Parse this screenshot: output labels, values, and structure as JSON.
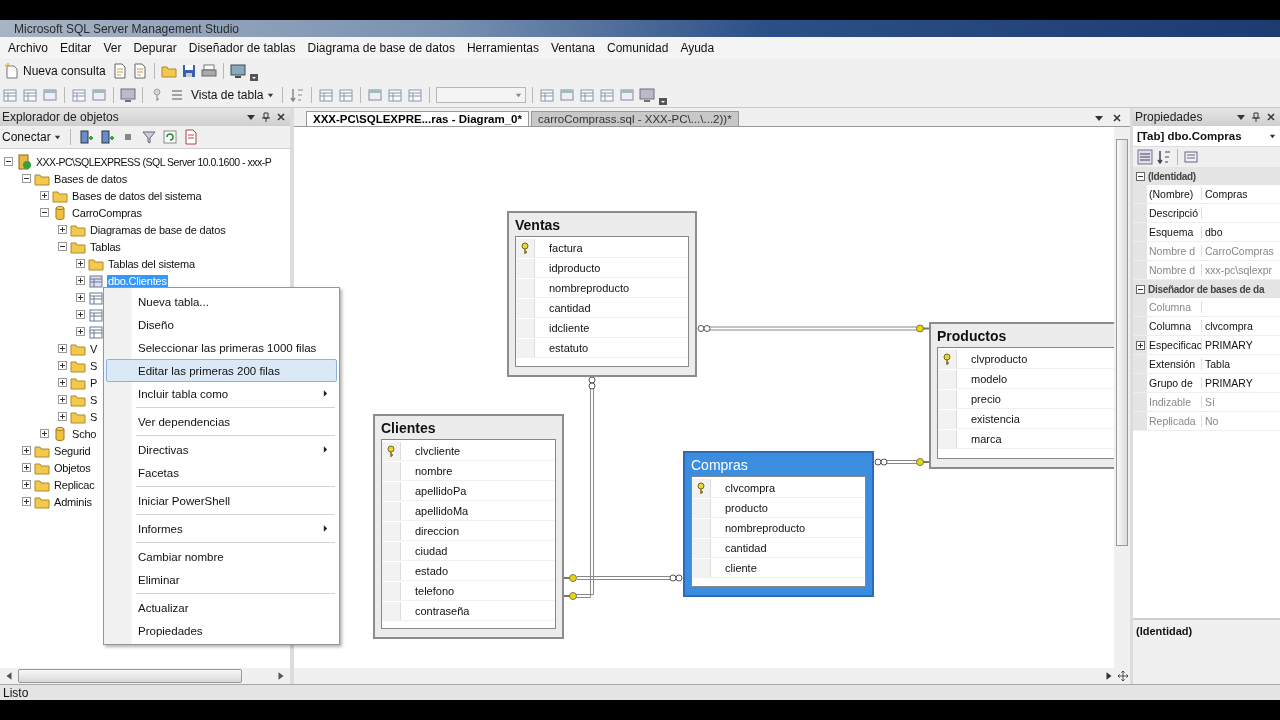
{
  "window": {
    "title": "Microsoft SQL Server Management Studio"
  },
  "menu": [
    "Archivo",
    "Editar",
    "Ver",
    "Depurar",
    "Diseñador de tablas",
    "Diagrama de base de datos",
    "Herramientas",
    "Ventana",
    "Comunidad",
    "Ayuda"
  ],
  "toolbar": {
    "new_query": "Nueva consulta",
    "view_button": "Vista de tabla"
  },
  "object_explorer": {
    "title": "Explorador de objetos",
    "connect": "Conectar",
    "tree": [
      {
        "label": "XXX-PC\\SQLEXPRESS (SQL Server 10.0.1600 - xxx-P",
        "kind": "server",
        "expanded": true,
        "selected": false,
        "children": [
          {
            "label": "Bases de datos",
            "kind": "folder",
            "expanded": true,
            "selected": false,
            "children": [
              {
                "label": "Bases de datos del sistema",
                "kind": "folder",
                "expanded": false,
                "selected": false
              },
              {
                "label": "CarroCompras",
                "kind": "database",
                "expanded": true,
                "selected": false,
                "children": [
                  {
                    "label": "Diagramas de base de datos",
                    "kind": "folder",
                    "expanded": false,
                    "selected": false
                  },
                  {
                    "label": "Tablas",
                    "kind": "folder",
                    "expanded": true,
                    "selected": false,
                    "children": [
                      {
                        "label": "Tablas del sistema",
                        "kind": "folder",
                        "expanded": false,
                        "selected": false
                      },
                      {
                        "label": "dbo.Clientes",
                        "kind": "table",
                        "expanded": false,
                        "selected": true
                      },
                      {
                        "kind": "table",
                        "expanded": false,
                        "selected": false
                      },
                      {
                        "kind": "table",
                        "expanded": false,
                        "selected": false
                      },
                      {
                        "kind": "table",
                        "expanded": false,
                        "selected": false
                      }
                    ]
                  },
                  {
                    "label": "V",
                    "kind": "folder",
                    "expanded": false,
                    "selected": false
                  },
                  {
                    "label": "S",
                    "kind": "folder",
                    "expanded": false,
                    "selected": false
                  },
                  {
                    "label": "P",
                    "kind": "folder",
                    "expanded": false,
                    "selected": false
                  },
                  {
                    "label": "S",
                    "kind": "folder",
                    "expanded": false,
                    "selected": false
                  },
                  {
                    "label": "S",
                    "kind": "folder",
                    "expanded": false,
                    "selected": false
                  }
                ]
              },
              {
                "label": "Scho",
                "kind": "database",
                "expanded": false,
                "selected": false
              }
            ]
          },
          {
            "label": "Segurid",
            "kind": "folder",
            "expanded": false,
            "selected": false
          },
          {
            "label": "Objetos",
            "kind": "folder",
            "expanded": false,
            "selected": false
          },
          {
            "label": "Replicac",
            "kind": "folder",
            "expanded": false,
            "selected": false
          },
          {
            "label": "Adminis",
            "kind": "folder",
            "expanded": false,
            "selected": false
          }
        ]
      }
    ]
  },
  "context_menu": {
    "groups": [
      [
        {
          "label": "Nueva tabla...",
          "has_submenu": false,
          "selected": false
        },
        {
          "label": "Diseño",
          "has_submenu": false,
          "selected": false
        },
        {
          "label": "Seleccionar las primeras 1000 filas",
          "has_submenu": false,
          "selected": false
        },
        {
          "label": "Editar las primeras 200 filas",
          "has_submenu": false,
          "selected": true
        },
        {
          "label": "Incluir tabla como",
          "has_submenu": true,
          "selected": false
        }
      ],
      [
        {
          "label": "Ver dependencias",
          "has_submenu": false,
          "selected": false
        }
      ],
      [
        {
          "label": "Directivas",
          "has_submenu": true,
          "selected": false
        },
        {
          "label": "Facetas",
          "has_submenu": false,
          "selected": false
        }
      ],
      [
        {
          "label": "Iniciar PowerShell",
          "has_submenu": false,
          "selected": false
        }
      ],
      [
        {
          "label": "Informes",
          "has_submenu": true,
          "selected": false
        }
      ],
      [
        {
          "label": "Cambiar nombre",
          "has_submenu": false,
          "selected": false
        },
        {
          "label": "Eliminar",
          "has_submenu": false,
          "selected": false
        }
      ],
      [
        {
          "label": "Actualizar",
          "has_submenu": false,
          "selected": false
        },
        {
          "label": "Propiedades",
          "has_submenu": false,
          "selected": false
        }
      ]
    ]
  },
  "tabs": [
    {
      "label": "XXX-PC\\SQLEXPRE...ras - Diagram_0*",
      "selected": true
    },
    {
      "label": "carroComprass.sql - XXX-PC\\...\\...2))*",
      "selected": false
    }
  ],
  "diagram": {
    "tables": [
      {
        "title": "Ventas",
        "selected": false,
        "columns": [
          {
            "name": "factura",
            "key": true
          },
          {
            "name": "idproducto",
            "key": false
          },
          {
            "name": "nombreproducto",
            "key": false
          },
          {
            "name": "cantidad",
            "key": false
          },
          {
            "name": "idcliente",
            "key": false
          },
          {
            "name": "estatuto",
            "key": false
          }
        ]
      },
      {
        "title": "Productos",
        "selected": false,
        "columns": [
          {
            "name": "clvproducto",
            "key": true
          },
          {
            "name": "modelo",
            "key": false
          },
          {
            "name": "precio",
            "key": false
          },
          {
            "name": "existencia",
            "key": false
          },
          {
            "name": "marca",
            "key": false
          }
        ]
      },
      {
        "title": "Clientes",
        "selected": false,
        "columns": [
          {
            "name": "clvcliente",
            "key": true
          },
          {
            "name": "nombre",
            "key": false
          },
          {
            "name": "apellidoPa",
            "key": false
          },
          {
            "name": "apellidoMa",
            "key": false
          },
          {
            "name": "direccion",
            "key": false
          },
          {
            "name": "ciudad",
            "key": false
          },
          {
            "name": "estado",
            "key": false
          },
          {
            "name": "telefono",
            "key": false
          },
          {
            "name": "contraseña",
            "key": false
          }
        ]
      },
      {
        "title": "Compras",
        "selected": true,
        "columns": [
          {
            "name": "clvcompra",
            "key": true
          },
          {
            "name": "producto",
            "key": false
          },
          {
            "name": "nombreproducto",
            "key": false
          },
          {
            "name": "cantidad",
            "key": false
          },
          {
            "name": "cliente",
            "key": false
          }
        ]
      }
    ]
  },
  "properties": {
    "title": "Propiedades",
    "object": "[Tab] dbo.Compras",
    "categories": [
      {
        "name": "(Identidad)",
        "expanded": true,
        "rows": [
          {
            "name": "(Nombre)",
            "value": "Compras",
            "disabled": false,
            "kind": "plain"
          },
          {
            "name": "Descripció",
            "disabled": false,
            "kind": "plain"
          },
          {
            "name": "Esquema",
            "value": "dbo",
            "disabled": false,
            "kind": "plain"
          },
          {
            "name": "Nombre d",
            "value": "CarroCompras",
            "disabled": true,
            "kind": "plain"
          },
          {
            "name": "Nombre d",
            "value": "xxx-pc\\sqlexpr",
            "disabled": true,
            "kind": "plain"
          }
        ]
      },
      {
        "name": "Diseñador de bases de da",
        "expanded": true,
        "rows": [
          {
            "name": "Columna",
            "disabled": true,
            "kind": "plain"
          },
          {
            "name": "Columna",
            "value": "clvcompra",
            "disabled": false,
            "kind": "plain"
          },
          {
            "name": "Especificac",
            "value": "PRIMARY",
            "disabled": false,
            "kind": "expandable",
            "expanded": false
          },
          {
            "name": "Extensión",
            "value": "Tabla",
            "disabled": false,
            "kind": "plain"
          },
          {
            "name": "Grupo de",
            "value": "PRIMARY",
            "disabled": false,
            "kind": "plain"
          },
          {
            "name": "Indizable",
            "value": "Sí",
            "disabled": true,
            "kind": "plain"
          },
          {
            "name": "Replicada",
            "value": "No",
            "disabled": true,
            "kind": "plain"
          }
        ]
      }
    ],
    "description_title": "(Identidad)"
  },
  "status_bar": "Listo"
}
